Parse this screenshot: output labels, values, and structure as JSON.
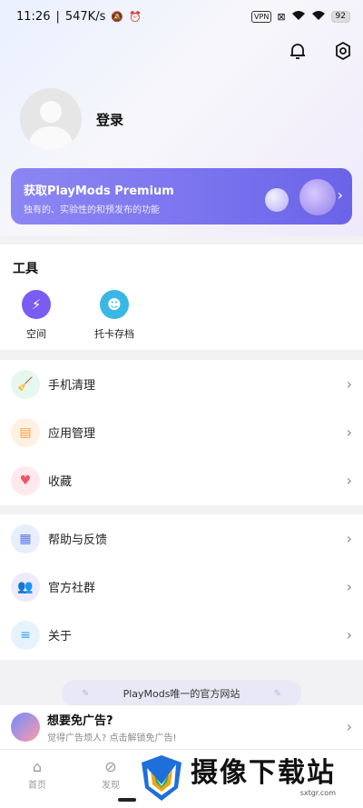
{
  "status_bar": {
    "time": "11:26",
    "speed": "547K/s",
    "vpn": "VPN",
    "battery": "92"
  },
  "header": {
    "icons": [
      "bell-icon",
      "settings-icon"
    ]
  },
  "profile": {
    "login_label": "登录"
  },
  "premium": {
    "title": "获取PlayMods Premium",
    "subtitle": "独有的、实验性的和预发布的功能"
  },
  "tools": {
    "title": "工具",
    "items": [
      {
        "label": "空间",
        "icon": "bolt-icon",
        "color": "#7b5cf2"
      },
      {
        "label": "托卡存档",
        "icon": "toca-avatar-icon",
        "color": "#39b7e6"
      }
    ]
  },
  "menu_group_1": [
    {
      "label": "手机清理",
      "icon": "broom-icon",
      "bg": "#e6f7ef",
      "fg": "#2cb67d"
    },
    {
      "label": "应用管理",
      "icon": "app-manage-icon",
      "bg": "#fff1e2",
      "fg": "#ff9a3d"
    },
    {
      "label": "收藏",
      "icon": "heart-icon",
      "bg": "#ffe9ec",
      "fg": "#f0566b"
    }
  ],
  "menu_group_2": [
    {
      "label": "帮助与反馈",
      "icon": "feedback-icon",
      "bg": "#e8eefc",
      "fg": "#5b7be6"
    },
    {
      "label": "官方社群",
      "icon": "community-icon",
      "bg": "#eeeafc",
      "fg": "#8a6ee8"
    },
    {
      "label": "关于",
      "icon": "about-icon",
      "bg": "#e6f3fd",
      "fg": "#3aa0ee"
    }
  ],
  "site_banner": {
    "text": "PlayMods唯一的官方网站"
  },
  "ad": {
    "title": "想要免广告?",
    "subtitle": "觉得广告烦人? 点击解锁免广告!"
  },
  "bottom_nav": [
    {
      "label": "首页",
      "icon": "home-icon"
    },
    {
      "label": "发现",
      "icon": "compass-icon"
    }
  ],
  "watermark": {
    "title": "摄像下载站",
    "url": "sxtgr.com"
  }
}
